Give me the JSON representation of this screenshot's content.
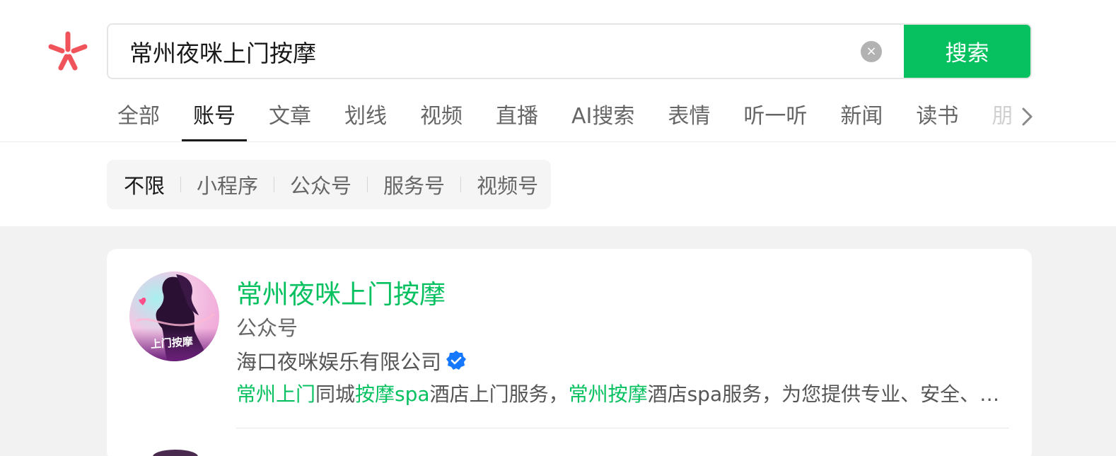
{
  "search": {
    "query": "常州夜咪上门按摩",
    "clear_icon": "×",
    "button_label": "搜索"
  },
  "tabs": [
    {
      "label": "全部"
    },
    {
      "label": "账号"
    },
    {
      "label": "文章"
    },
    {
      "label": "划线"
    },
    {
      "label": "视频"
    },
    {
      "label": "直播"
    },
    {
      "label": "AI搜索"
    },
    {
      "label": "表情"
    },
    {
      "label": "听一听"
    },
    {
      "label": "新闻"
    },
    {
      "label": "读书"
    },
    {
      "label": "朋"
    }
  ],
  "active_tab": "账号",
  "filters": [
    {
      "label": "不限"
    },
    {
      "label": "小程序"
    },
    {
      "label": "公众号"
    },
    {
      "label": "服务号"
    },
    {
      "label": "视频号"
    }
  ],
  "active_filter": "不限",
  "result": {
    "name": "常州夜咪上门按摩",
    "type": "公众号",
    "org": "海口夜咪娱乐有限公司",
    "avatar_text": "上门按摩",
    "desc_parts": [
      {
        "text": "常州上门",
        "hl": true
      },
      {
        "text": "同城",
        "hl": false
      },
      {
        "text": "按摩spa",
        "hl": true
      },
      {
        "text": "酒店上门服务，",
        "hl": false
      },
      {
        "text": "常州按摩",
        "hl": true
      },
      {
        "text": "酒店spa服务，为您提供专业、安全、快…",
        "hl": false
      }
    ]
  },
  "colors": {
    "accent": "#07c160",
    "logo": "#f0535a",
    "verified": "#1677ff"
  }
}
